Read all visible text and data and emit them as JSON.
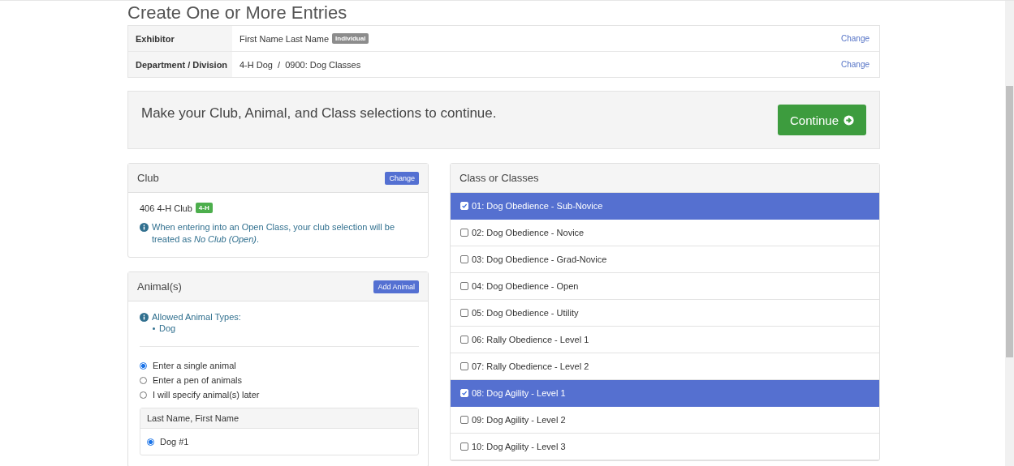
{
  "page_title": "Create One or More Entries",
  "summary": [
    {
      "label": "Exhibitor",
      "value": "First Name Last Name",
      "badge": "Individual",
      "action": "Change"
    },
    {
      "label": "Department / Division",
      "value": "4-H Dog  /  0900: Dog Classes",
      "action": "Change"
    }
  ],
  "notice": {
    "text": "Make your Club, Animal, and Class selections to continue.",
    "button": "Continue"
  },
  "club": {
    "title": "Club",
    "button": "Change",
    "name": "406 4-H Club",
    "badge": "4-H",
    "info": "When entering into an Open Class, your club selection will be treated as *No Club (Open)*."
  },
  "animals": {
    "title": "Animal(s)",
    "button": "Add Animal",
    "allowed_label": "Allowed Animal Types:",
    "allowed_types": [
      "Dog"
    ],
    "modes": [
      {
        "label": "Enter a single animal",
        "selected": true
      },
      {
        "label": "Enter a pen of animals",
        "selected": false
      },
      {
        "label": "I will specify animal(s) later",
        "selected": false
      }
    ],
    "list_header": "Last Name, First Name",
    "list": [
      {
        "label": "Dog #1",
        "selected": true
      }
    ]
  },
  "classes": {
    "title": "Class or Classes",
    "items": [
      {
        "label": "01: Dog Obedience - Sub-Novice",
        "checked": true
      },
      {
        "label": "02: Dog Obedience - Novice",
        "checked": false
      },
      {
        "label": "03: Dog Obedience - Grad-Novice",
        "checked": false
      },
      {
        "label": "04: Dog Obedience - Open",
        "checked": false
      },
      {
        "label": "05: Dog Obedience - Utility",
        "checked": false
      },
      {
        "label": "06: Rally Obedience - Level 1",
        "checked": false
      },
      {
        "label": "07: Rally Obedience - Level 2",
        "checked": false
      },
      {
        "label": "08: Dog Agility - Level 1",
        "checked": true
      },
      {
        "label": "09: Dog Agility - Level 2",
        "checked": false
      },
      {
        "label": "10: Dog Agility - Level 3",
        "checked": false
      }
    ]
  }
}
